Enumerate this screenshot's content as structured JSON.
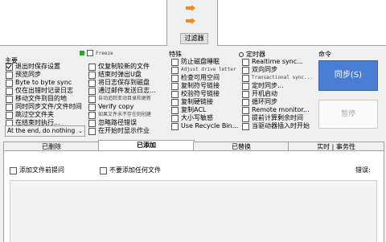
{
  "top": {
    "filter_button": "过滤器"
  },
  "main_group": {
    "title": "主要",
    "items": [
      {
        "label": "退出时保存设置",
        "checked": true
      },
      {
        "label": "预览同步",
        "checked": false
      },
      {
        "label": "Byte to byte sync",
        "checked": false
      },
      {
        "label": "仅在出错时记录日志",
        "checked": false
      },
      {
        "label": "移动文件到目的地",
        "checked": false
      },
      {
        "label": "同时同步文件/文件时间",
        "checked": false
      },
      {
        "label": "跳过空文件夹",
        "checked": false
      },
      {
        "label": "在结束时执行...",
        "checked": false
      }
    ],
    "end_select": "At the end, do nothing"
  },
  "col2": {
    "freeze_label": "Freeze",
    "items": [
      {
        "label": "仅复制较新的文件",
        "small": false
      },
      {
        "label": "结束时弹出U盘",
        "small": false
      },
      {
        "label": "将日志保存到磁盘",
        "small": false
      },
      {
        "label": "通过邮件发送日志...",
        "small": false
      },
      {
        "label": "自动追踪变动目录和更新",
        "small": true
      },
      {
        "label": "Verify copy",
        "small": false
      },
      {
        "label": "如果文件未不存在则创建",
        "small": true
      },
      {
        "label": "忽略路径错误",
        "small": false
      },
      {
        "label": "在开始时显示作业",
        "small": false
      }
    ]
  },
  "special_group": {
    "title": "特殊",
    "items": [
      {
        "label": "防止磁盘睡眠",
        "small": false
      },
      {
        "label": "Adjust drive letter",
        "small": true
      },
      {
        "label": "检查可用空间",
        "small": false
      },
      {
        "label": "复制符号链接",
        "small": false
      },
      {
        "label": "校验符号链接",
        "small": false
      },
      {
        "label": "复制硬链接",
        "small": false
      },
      {
        "label": "复制ACL",
        "small": false
      },
      {
        "label": "大小写敏感",
        "small": false
      },
      {
        "label": "Use Recycle Bin...",
        "small": false
      }
    ]
  },
  "timer_group": {
    "title": "定时器",
    "items": [
      {
        "label": "Realtime sync...",
        "small": false
      },
      {
        "label": "双向同步",
        "small": false
      },
      {
        "label": "Transactional sync...",
        "small": true
      },
      {
        "label": "定时同步...",
        "small": false
      },
      {
        "label": "开机启动",
        "small": false
      },
      {
        "label": "循环同步",
        "small": false
      },
      {
        "label": "Remote monitor...",
        "small": false
      },
      {
        "label": "提前计算剩余时间",
        "small": false
      },
      {
        "label": "当驱动器插入时开始",
        "small": false
      }
    ]
  },
  "commands": {
    "title": "命令",
    "sync_button": "同步(S)",
    "pause_button": "暂停"
  },
  "tabs": [
    "已删除",
    "已添加",
    "已替换",
    "实时 | 事务性"
  ],
  "bottom": {
    "add_parent": "添加文件前提问",
    "no_add": "不要添加任何文件",
    "errors_label": "错误:"
  },
  "colors": {
    "accent": "#4a7dd6",
    "freeze_green": "#22aa22",
    "arrow_orange": "#f08a1c"
  }
}
